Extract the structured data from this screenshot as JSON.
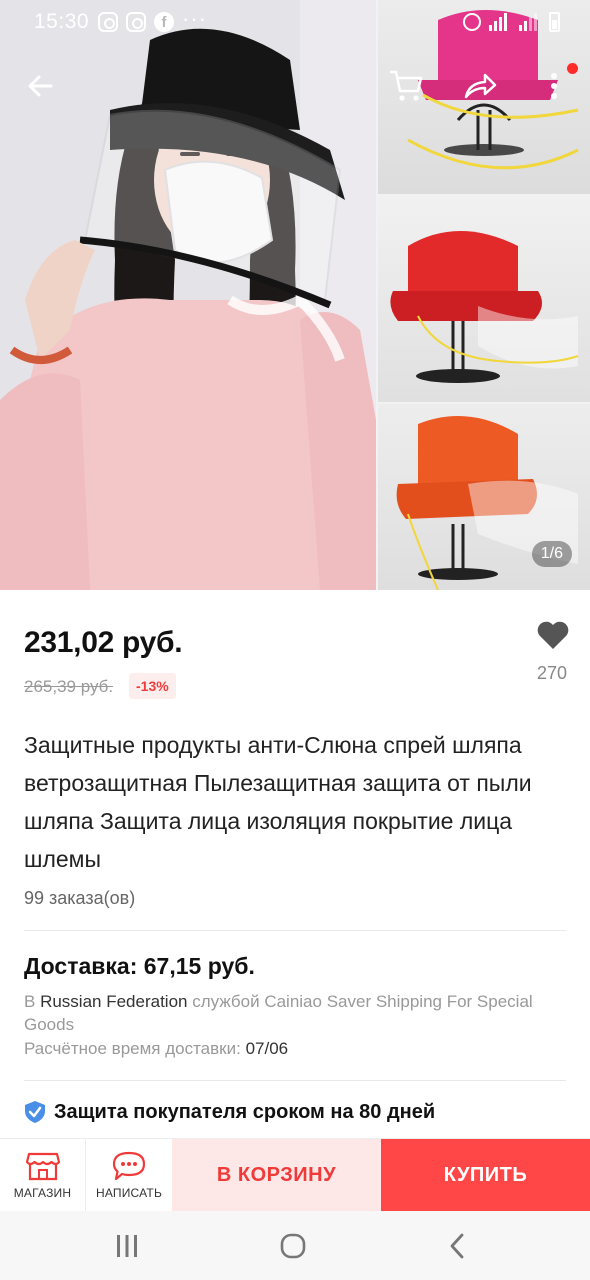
{
  "status_bar": {
    "time": "15:30",
    "network": "4G+"
  },
  "gallery": {
    "counter": "1/6"
  },
  "product": {
    "price": "231,02 руб.",
    "old_price": "265,39 руб.",
    "discount": "-13%",
    "wishlist_count": "270",
    "title": "Защитные продукты анти-Слюна спрей шляпа ветрозащитная Пылезащитная защита от пыли шляпа Защита лица изоляция покрытие лица шлемы",
    "orders": "99 заказа(ов)"
  },
  "delivery": {
    "title": "Доставка: 67,15 руб.",
    "prefix": "В",
    "country": "Russian Federation",
    "service": "службой Cainiao Saver Shipping For Special Goods",
    "eta_label": "Расчётное время доставки:",
    "eta_date": "07/06"
  },
  "protection": {
    "text": "Защита покупателя сроком на 80 дней"
  },
  "action_bar": {
    "store_label": "МАГАЗИН",
    "chat_label": "НАПИСАТЬ",
    "cart_label": "В КОРЗИНУ",
    "buy_label": "КУПИТЬ"
  },
  "colors": {
    "accent": "#ff4747",
    "accent_light": "#fde7e7",
    "discount_text": "#f23b3b",
    "shield": "#4a8fe7"
  },
  "icons": {
    "back": "arrow-left-icon",
    "cart": "cart-icon",
    "share": "share-icon",
    "more": "more-vertical-icon",
    "wishlist": "heart-icon",
    "store": "store-icon",
    "chat": "chat-icon",
    "protection": "shield-check-icon"
  }
}
